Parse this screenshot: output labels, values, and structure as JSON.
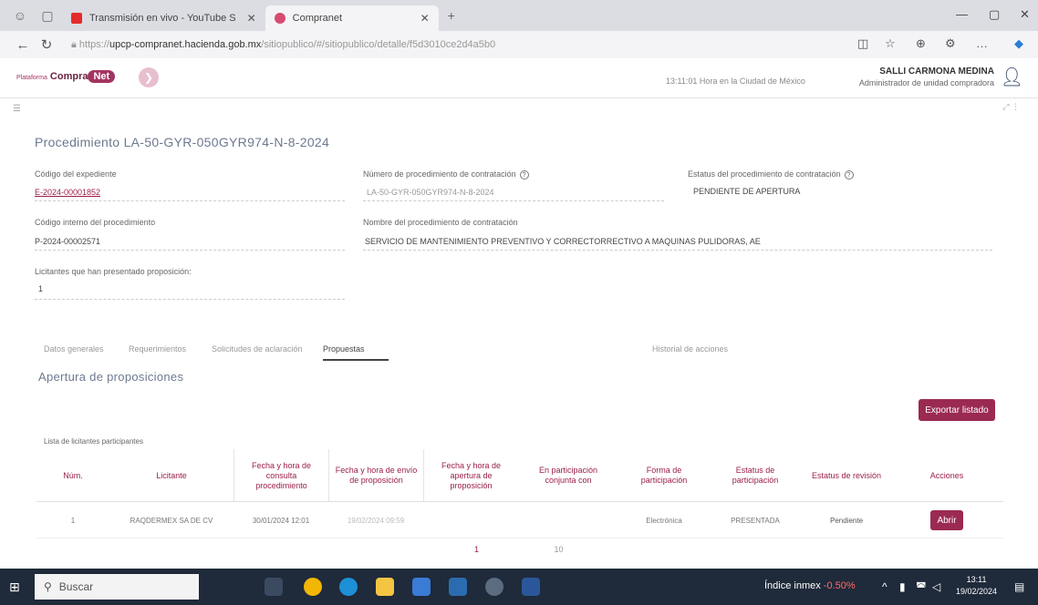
{
  "browser": {
    "tabs": [
      {
        "title": "Transmisión en vivo - YouTube S",
        "active": false,
        "favicon_color": "#e32c2c"
      },
      {
        "title": "Compranet",
        "active": true,
        "favicon_color": "#d64b6f"
      }
    ],
    "url_prefix": "https://",
    "url_host": "upcp-compranet.hacienda.gob.mx",
    "url_rest": "/sitiopublico/#/sitiopublico/detalle/f5d3010ce2d4a5b0"
  },
  "app": {
    "logo_prefix": "Plataforma",
    "logo_text": "Compra",
    "logo_pill": "Net",
    "header_time": "13:11:01 Hora en la Ciudad de México",
    "user_name": "SALLI CARMONA MEDINA",
    "user_role": "Administrador de unidad compradora"
  },
  "procedure": {
    "title": "Procedimiento LA-50-GYR-050GYR974-N-8-2024",
    "fields": {
      "codigo_expediente_label": "Código del expediente",
      "codigo_expediente_value": "E-2024-00001852",
      "numero_label": "Número de procedimiento de contratación",
      "numero_value": "LA-50-GYR-050GYR974-N-8-2024",
      "estatus_label": "Estatus del procedimiento de contratación",
      "estatus_value": "PENDIENTE DE APERTURA",
      "codigo_interno_label": "Código interno del procedimiento",
      "codigo_interno_value": "P-2024-00002571",
      "nombre_label": "Nombre del procedimiento de contratación",
      "nombre_value": "SERVICIO DE MANTENIMIENTO PREVENTIVO Y CORRECTORRECTIVO A MAQUINAS PULIDORAS, AE",
      "licitantes_label": "Licitantes que han presentado proposición:",
      "licitantes_value": "1"
    }
  },
  "tabs": [
    {
      "label": "Datos generales",
      "active": false
    },
    {
      "label": "Requerimientos",
      "active": false
    },
    {
      "label": "Solicitudes de aclaración",
      "active": false
    },
    {
      "label": "Propuestas",
      "active": true
    },
    {
      "label": "Historial de acciones",
      "active": false
    }
  ],
  "apertura": {
    "title": "Apertura de proposiciones",
    "export_label": "Exportar listado",
    "list_title": "Lista de licitantes participantes",
    "headers": [
      "Núm.",
      "Licitante",
      "Fecha y hora de consulta procedimiento",
      "Fecha y hora de envío de proposición",
      "Fecha y hora de apertura de proposición",
      "En participación conjunta con",
      "Forma de participación",
      "Estatus de participación",
      "Estatus de revisión",
      "Acciones"
    ],
    "rows": [
      {
        "num": "1",
        "licitante": "RAQDERMEX SA DE CV",
        "consulta": "30/01/2024 12:01",
        "envio": "19/02/2024 09:59",
        "apertura": "",
        "conjunta": "",
        "forma": "Electrónica",
        "estatus_participacion": "PRESENTADA",
        "estatus_revision": "Pendiente",
        "accion": "Abrir"
      }
    ],
    "pager_current": "1",
    "pager_size": "10"
  },
  "taskbar": {
    "search_placeholder": "Buscar",
    "indice_label": "Índice inmex",
    "indice_change": "-0.50%",
    "time": "13:11",
    "date": "19/02/2024"
  }
}
